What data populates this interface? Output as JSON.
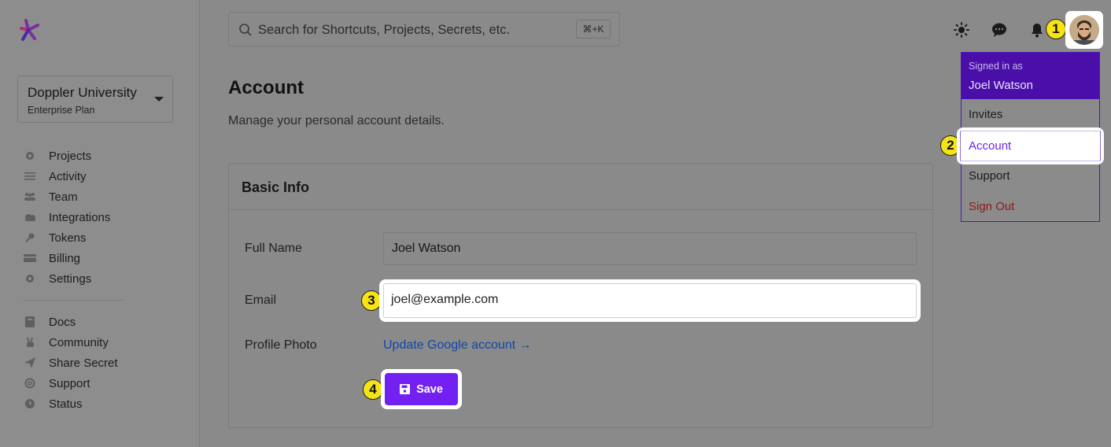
{
  "search": {
    "placeholder": "Search for Shortcuts, Projects, Secrets, etc.",
    "shortcut": "⌘+K"
  },
  "org": {
    "name": "Doppler University",
    "plan": "Enterprise Plan"
  },
  "sidebar": {
    "primary": [
      {
        "label": "Projects",
        "icon": "gear-icon"
      },
      {
        "label": "Activity",
        "icon": "list-icon"
      },
      {
        "label": "Team",
        "icon": "team-icon"
      },
      {
        "label": "Integrations",
        "icon": "cloud-icon"
      },
      {
        "label": "Tokens",
        "icon": "key-icon"
      },
      {
        "label": "Billing",
        "icon": "credit-card-icon"
      },
      {
        "label": "Settings",
        "icon": "settings-icon"
      }
    ],
    "secondary": [
      {
        "label": "Docs",
        "icon": "book-icon"
      },
      {
        "label": "Community",
        "icon": "peace-hand-icon"
      },
      {
        "label": "Share Secret",
        "icon": "paper-plane-icon"
      },
      {
        "label": "Support",
        "icon": "lifebuoy-icon"
      },
      {
        "label": "Status",
        "icon": "clock-icon"
      }
    ]
  },
  "page": {
    "title": "Account",
    "subtitle": "Manage your personal account details."
  },
  "card": {
    "title": "Basic Info",
    "full_name_label": "Full Name",
    "full_name_value": "Joel Watson",
    "email_label": "Email",
    "email_value": "joel@example.com",
    "photo_label": "Profile Photo",
    "photo_link": "Update Google account →",
    "save_label": "Save"
  },
  "user_menu": {
    "signed_in_as": "Signed in as",
    "user_name": "Joel Watson",
    "items": [
      "Invites",
      "Account",
      "Support",
      "Sign Out"
    ]
  },
  "step_badges": [
    "1",
    "2",
    "3",
    "4"
  ],
  "colors": {
    "accent": "#7321f2",
    "menu_header": "#4a0fa8",
    "badge": "#f5e315",
    "link": "#1147a8",
    "sign_out": "#8e1a1a"
  }
}
